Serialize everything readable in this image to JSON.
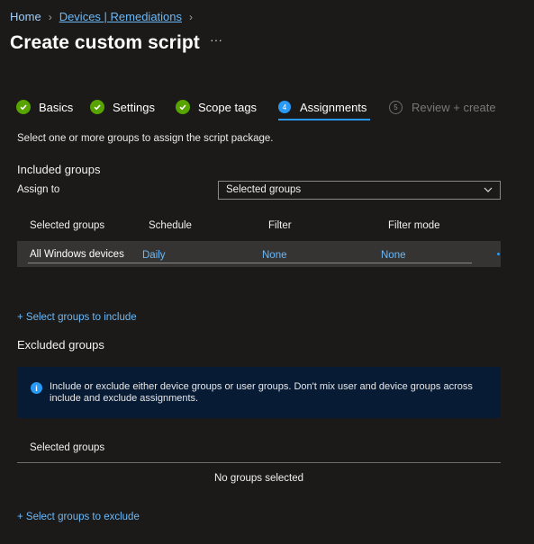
{
  "breadcrumb": {
    "home": "Home",
    "devices": "Devices | Remediations"
  },
  "page": {
    "title": "Create custom script",
    "more": "···"
  },
  "steps": [
    {
      "label": "Basics",
      "state": "done"
    },
    {
      "label": "Settings",
      "state": "done"
    },
    {
      "label": "Scope tags",
      "state": "done"
    },
    {
      "label": "Assignments",
      "state": "active",
      "number": "4"
    },
    {
      "label": "Review + create",
      "state": "pending",
      "number": "5"
    }
  ],
  "description": "Select one or more groups to assign the script package.",
  "included": {
    "heading": "Included groups",
    "assign_label": "Assign to",
    "assign_value": "Selected groups",
    "columns": [
      "Selected groups",
      "Schedule",
      "Filter",
      "Filter mode"
    ],
    "rows": [
      {
        "group": "All Windows devices",
        "schedule": "Daily",
        "filter": "None",
        "filter_mode": "None"
      }
    ],
    "add_link": "+ Select groups to include"
  },
  "excluded": {
    "heading": "Excluded groups",
    "info": "Include or exclude either device groups or user groups. Don't mix user and device groups across include and exclude assignments.",
    "column": "Selected groups",
    "empty": "No groups selected",
    "add_link": "+ Select groups to exclude"
  },
  "colors": {
    "accent": "#2899f5",
    "link": "#6cb8f6",
    "success": "#57a300",
    "background": "#1b1a19",
    "info_bg": "#071b35"
  }
}
